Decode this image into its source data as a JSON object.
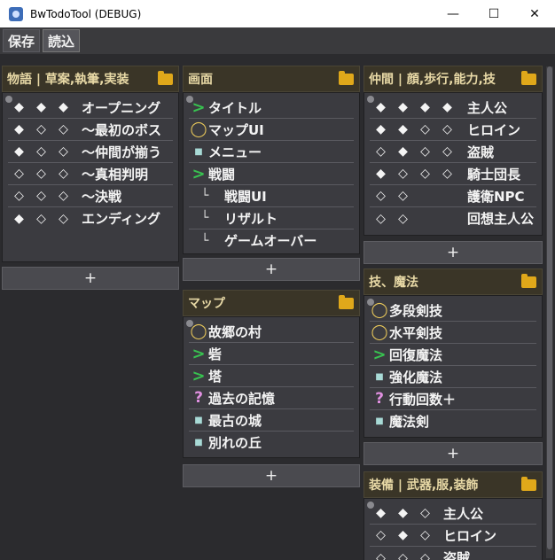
{
  "window": {
    "title": "BwTodoTool (DEBUG)",
    "min_label": "—",
    "max_label": "☐",
    "close_label": "✕"
  },
  "menu": {
    "save_label": "保存",
    "load_label": "読込"
  },
  "add_label": "+",
  "panels": {
    "story": {
      "title": "物語 | 草案,執筆,実装",
      "rows": [
        {
          "marks": [
            "◆",
            "◆",
            "◆"
          ],
          "label": "オープニング"
        },
        {
          "marks": [
            "◆",
            "◇",
            "◇"
          ],
          "label": "～最初のボス"
        },
        {
          "marks": [
            "◆",
            "◇",
            "◇"
          ],
          "label": "～仲間が揃う"
        },
        {
          "marks": [
            "◇",
            "◇",
            "◇"
          ],
          "label": "～真相判明"
        },
        {
          "marks": [
            "◇",
            "◇",
            "◇"
          ],
          "label": "～決戦"
        },
        {
          "marks": [
            "◆",
            "◇",
            "◇"
          ],
          "label": "エンディング"
        }
      ]
    },
    "screens": {
      "title": "画面",
      "rows": [
        {
          "icon": "gt",
          "label": "タイトル"
        },
        {
          "icon": "circ",
          "label": "マップUI"
        },
        {
          "icon": "sq",
          "label": "メニュー"
        },
        {
          "icon": "gt",
          "label": "戦闘"
        },
        {
          "icon": "sub",
          "label": "戦闘UI"
        },
        {
          "icon": "sub",
          "label": "リザルト"
        },
        {
          "icon": "sub",
          "label": "ゲームオーバー"
        }
      ]
    },
    "maps": {
      "title": "マップ",
      "rows": [
        {
          "icon": "circ",
          "label": "故郷の村"
        },
        {
          "icon": "gt",
          "label": "砦"
        },
        {
          "icon": "gt",
          "label": "塔"
        },
        {
          "icon": "q",
          "label": "過去の記憶"
        },
        {
          "icon": "sq",
          "label": "最古の城"
        },
        {
          "icon": "sq",
          "label": "別れの丘"
        }
      ]
    },
    "party": {
      "title": "仲間 | 顔,歩行,能力,技",
      "rows": [
        {
          "marks": [
            "◆",
            "◆",
            "◆",
            "◆"
          ],
          "label": "主人公"
        },
        {
          "marks": [
            "◆",
            "◆",
            "◇",
            "◇"
          ],
          "label": "ヒロイン"
        },
        {
          "marks": [
            "◇",
            "◆",
            "◇",
            "◇"
          ],
          "label": "盗賊"
        },
        {
          "marks": [
            "◆",
            "◇",
            "◇",
            "◇"
          ],
          "label": "騎士団長"
        },
        {
          "marks": [
            "◇",
            "◇",
            "",
            ""
          ],
          "label": "護衛NPC"
        },
        {
          "marks": [
            "◇",
            "◇",
            "",
            ""
          ],
          "label": "回想主人公"
        }
      ]
    },
    "skills": {
      "title": "技、魔法",
      "rows": [
        {
          "icon": "circ",
          "label": "多段剣技"
        },
        {
          "icon": "circ",
          "label": "水平剣技"
        },
        {
          "icon": "gt",
          "label": "回復魔法"
        },
        {
          "icon": "sq",
          "label": "強化魔法"
        },
        {
          "icon": "q",
          "label": "行動回数＋"
        },
        {
          "icon": "sq",
          "label": "魔法剣"
        }
      ]
    },
    "equip": {
      "title": "装備 | 武器,服,装飾",
      "rows": [
        {
          "marks": [
            "◆",
            "◆",
            "◇"
          ],
          "label": "主人公"
        },
        {
          "marks": [
            "◇",
            "◆",
            "◇"
          ],
          "label": "ヒロイン"
        },
        {
          "marks": [
            "◇",
            "◇",
            "◇"
          ],
          "label": "盗賊"
        }
      ]
    }
  },
  "icons": {
    "gt": ">",
    "circ": "◯",
    "sq": "■",
    "q": "?",
    "sub": "└"
  },
  "colors": {
    "header_bg": "#3a3527",
    "header_text": "#e8d9a6",
    "done_green": "#38c250",
    "progress_yellow": "#e6c65a",
    "unknown_pink": "#e090e0",
    "todo_cyan": "#a8dad6",
    "folder": "#e0a81a"
  }
}
